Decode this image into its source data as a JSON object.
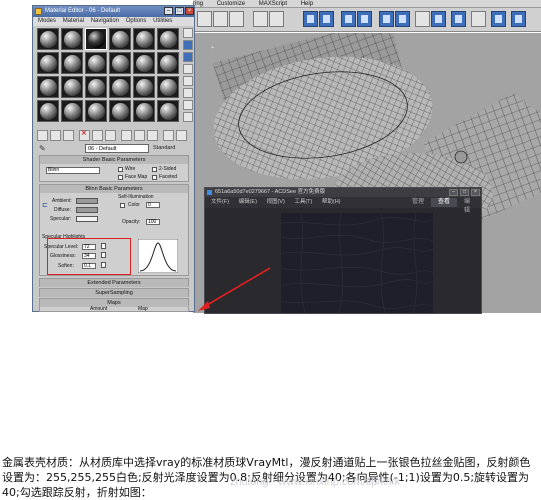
{
  "max": {
    "menubar": [
      "ring",
      "Customize",
      "MAXScript",
      "Help"
    ]
  },
  "material_editor": {
    "title": "Material Editor - 06 - Default",
    "menu": [
      "Modes",
      "Material",
      "Navigation",
      "Options",
      "Utilities"
    ],
    "material_name": "06 - Default",
    "material_type": "Standard",
    "shader_basic": {
      "title": "Shader Basic Parameters",
      "shader": "Blinn",
      "options": [
        "Wire",
        "2-Sided",
        "Face Map",
        "Faceted"
      ]
    },
    "blinn_basic": {
      "title": "Blinn Basic Parameters",
      "self_illum_title": "Self-Illumination",
      "color_label": "Color",
      "color_value": "0",
      "opacity_label": "Opacity:",
      "opacity_value": "100",
      "ambient_label": "Ambient:",
      "diffuse_label": "Diffuse:",
      "specular_label": "Specular:"
    },
    "specular_highlights": {
      "title": "Specular Highlights",
      "level_label": "Specular Level:",
      "level_value": "72",
      "gloss_label": "Glossiness:",
      "gloss_value": "34",
      "soften_label": "Soften:",
      "soften_value": "0.1"
    },
    "rollouts": {
      "extended": "Extended Parameters",
      "supersampling": "SuperSampling",
      "maps": "Maps",
      "amount": "Amount",
      "map": "Map"
    }
  },
  "acdsee": {
    "title": "651a6a50d7e0279667 - ACDSee 官方免费版",
    "menu": [
      "文件(F)",
      "编辑(E)",
      "视图(V)",
      "工具(T)",
      "帮助(H)"
    ],
    "modes": [
      "管理",
      "查看",
      "编辑"
    ],
    "active_mode": "查看"
  },
  "caption": {
    "text": "金属表壳材质：从材质库中选择vray的标准材质球VrayMtl，漫反射通道贴上一张银色拉丝金贴图，反射颜色设置为：255,255,255白色;反射光泽度设置为0.8;反射细分设置为40;各向异性(-1;1)设置为0.5;旋转设置为40;勾选跟踪反射，折射如图：",
    "watermark": "zhulong · www.xinxinp.com/tip/k/kk"
  },
  "colors": {
    "highlight_box": "#e02020",
    "arrow": "#e02020",
    "titlebar": "#4b6ba5",
    "acdsee_bg": "#2a2a2e"
  }
}
